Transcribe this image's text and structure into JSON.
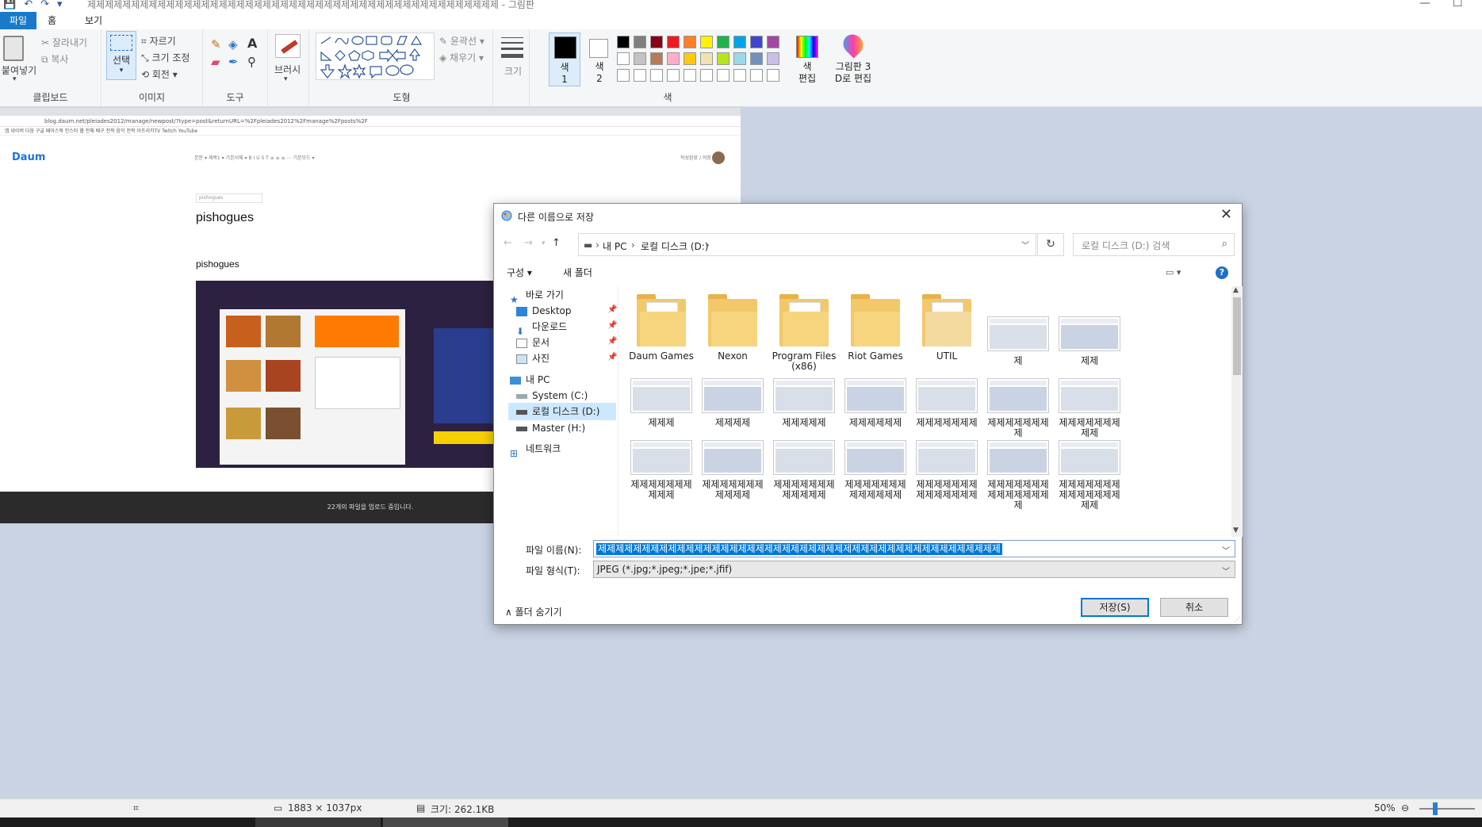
{
  "window": {
    "title": "제제제제제제제제제제제제제제제제제제제제제제제제제제제제제제제제제제제제제제제제제제제제제제제 - 그림판"
  },
  "menu": {
    "file": "파일",
    "home": "홈",
    "view": "보기"
  },
  "ribbon": {
    "clipboard": {
      "paste": "붙여넣기",
      "cut": "잘라내기",
      "copy": "복사",
      "label": "클립보드"
    },
    "image": {
      "select": "선택",
      "crop": "자르기",
      "resize": "크기 조정",
      "rotate": "회전",
      "label": "이미지"
    },
    "tools": {
      "label": "도구"
    },
    "brush": {
      "label": "브러시"
    },
    "shapes": {
      "outline": "윤곽선",
      "fill": "채우기",
      "label": "도형"
    },
    "size": {
      "label": "크기"
    },
    "colors": {
      "color1": "색\n1",
      "color1_a": "색",
      "color1_b": "1",
      "color2_a": "색",
      "color2_b": "2",
      "edit_a": "색",
      "edit_b": "편집",
      "paint3d_a": "그림판 3",
      "paint3d_b": "D로 편집",
      "label": "색",
      "palette_row1": [
        "#000000",
        "#7f7f7f",
        "#880015",
        "#ed1c24",
        "#ff7f27",
        "#fff200",
        "#22b14c",
        "#00a2e8",
        "#3f48cc",
        "#a349a4"
      ],
      "palette_row2": [
        "#ffffff",
        "#c3c3c3",
        "#b97a57",
        "#ffaec9",
        "#ffc90e",
        "#efe4b0",
        "#b5e61d",
        "#99d9ea",
        "#7092be",
        "#c8bfe7"
      ]
    }
  },
  "screenshot": {
    "url": "blog.daum.net/pleiades2012/manage/newpost/?type=post&returnURL=%2Fpleiades2012%2Fmanage%2Fposts%2F",
    "bookmarks": "앱  네이버  다음  구글  페이스북  인스타  웹 전체  배구 전적  음악 전적  아프리카TV  Twitch  YouTube",
    "logo": "Daum",
    "editor_tools": "본문 ▾  제목1 ▾  기본서체 ▾   B  I  U  S  T   ≡  ≡  ≡   ⋯   기본모드 ▾",
    "save_buttons": "작성완료 / 저장",
    "category": "pishogues",
    "post_title": "pishogues",
    "post_body": "pishogues",
    "upload_msg": "22개의 파일을 업로드 중입니다."
  },
  "dialog": {
    "title": "다른 이름으로 저장",
    "breadcrumb": [
      "내 PC",
      "로컬 디스크 (D:)"
    ],
    "search_placeholder": "로컬 디스크 (D:) 검색",
    "organize": "구성 ▾",
    "new_folder": "새 폴더",
    "nav": [
      {
        "label": "바로 가기",
        "icon": "star-icon"
      },
      {
        "label": "Desktop",
        "icon": "desktop-icon",
        "pinned": true
      },
      {
        "label": "다운로드",
        "icon": "download-icon",
        "pinned": true
      },
      {
        "label": "문서",
        "icon": "document-icon",
        "pinned": true
      },
      {
        "label": "사진",
        "icon": "picture-icon",
        "pinned": true
      },
      {
        "label": "내 PC",
        "icon": "pc-icon"
      },
      {
        "label": "System (C:)",
        "icon": "drive-icon"
      },
      {
        "label": "로컬 디스크 (D:)",
        "icon": "drive-icon",
        "selected": true
      },
      {
        "label": "Master (H:)",
        "icon": "drive-icon"
      },
      {
        "label": "네트워크",
        "icon": "network-icon"
      }
    ],
    "folders": [
      "Daum Games",
      "Nexon",
      "Program Files (x86)",
      "Riot Games",
      "UTIL"
    ],
    "files_row1": [
      "제",
      "제제"
    ],
    "files_row2": [
      "제제제",
      "제제제제",
      "제제제제제",
      "제제제제제제",
      "제제제제제제제",
      "제제제제제제제제",
      "제제제제제제제제제"
    ],
    "files_row3": [
      "제제제제제제제제제제",
      "제제제제제제제제제제제",
      "제제제제제제제제제제제제",
      "제제제제제제제제제제제제제",
      "제제제제제제제제제제제제제제",
      "제제제제제제제제제제제제제제제",
      "제제제제제제제제제제제제제제제제"
    ],
    "filename_label": "파일 이름(N):",
    "filename_value": "제제제제제제제제제제제제제제제제제제제제제제제제제제제제제제제제제제제제제제제제제제제제제제",
    "filetype_label": "파일 형식(T):",
    "filetype_value": "JPEG (*.jpg;*.jpeg;*.jpe;*.jfif)",
    "hide_folders": "폴더 숨기기",
    "save": "저장(S)",
    "cancel": "취소"
  },
  "statusbar": {
    "dimensions": "1883 × 1037px",
    "size": "크기: 262.1KB",
    "zoom": "50%"
  }
}
